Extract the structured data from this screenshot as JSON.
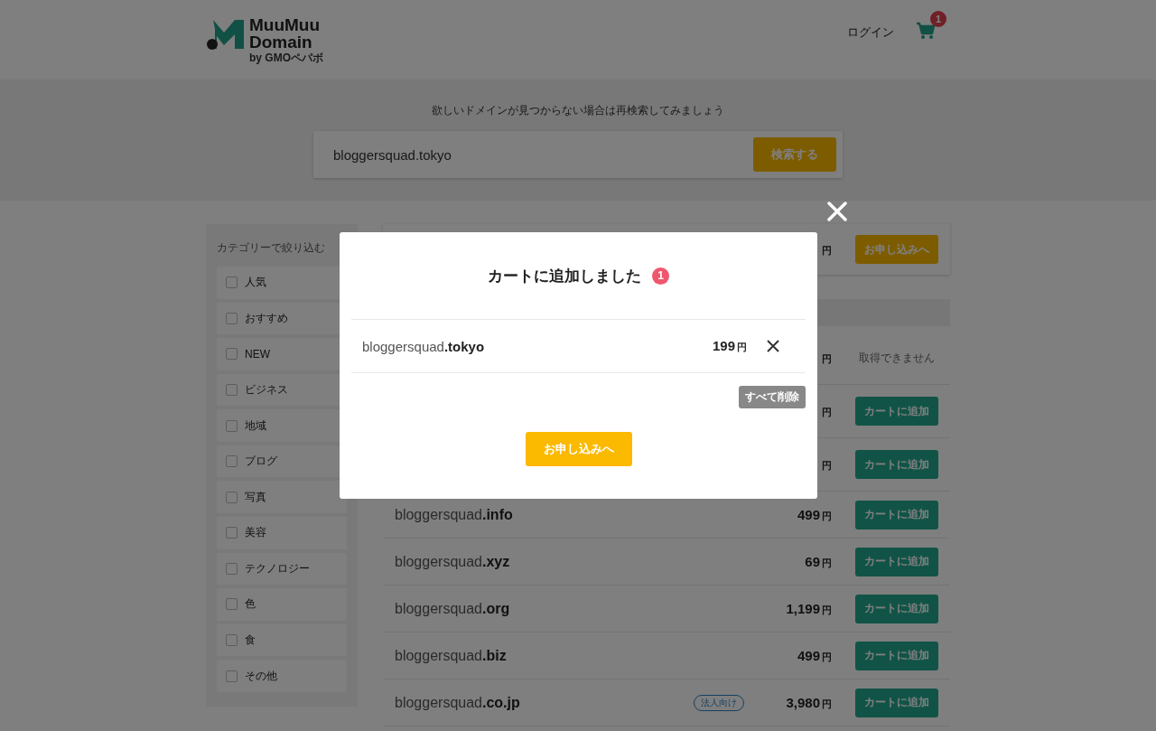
{
  "header": {
    "logo": {
      "line1": "MuuMuu",
      "line2": "Domain",
      "byline": "by GMOペパボ"
    },
    "login": "ログイン",
    "cart_count": "1"
  },
  "search": {
    "prompt": "欲しいドメインが見つからない場合は再検索してみましょう",
    "value": "bloggersquad.tokyo",
    "button": "検索する"
  },
  "sidebar": {
    "title": "カテゴリーで絞り込む",
    "categories": [
      {
        "label": "人気",
        "checked": false
      },
      {
        "label": "おすすめ",
        "checked": false
      },
      {
        "label": "NEW",
        "checked": false
      },
      {
        "label": "ビジネス",
        "checked": false
      },
      {
        "label": "地域",
        "checked": false
      },
      {
        "label": "ブログ",
        "checked": false
      },
      {
        "label": "写真",
        "checked": false
      },
      {
        "label": "美容",
        "checked": false
      },
      {
        "label": "テクノロジー",
        "checked": false
      },
      {
        "label": "色",
        "checked": false
      },
      {
        "label": "食",
        "checked": false
      },
      {
        "label": "その他",
        "checked": false
      }
    ]
  },
  "featured": {
    "currency": "円",
    "button": "お申し込みへ"
  },
  "results": [
    {
      "kind": "unavailable",
      "currency": "円",
      "status": "取得できません"
    },
    {
      "kind": "available",
      "currency": "円",
      "button": "カートに追加"
    },
    {
      "kind": "available",
      "currency": "円",
      "button": "カートに追加"
    },
    {
      "kind": "available",
      "domain": "bloggersquad**.info**",
      "price": "499",
      "currency": "円",
      "button": "カートに追加"
    },
    {
      "kind": "available",
      "domain": "bloggersquad**.xyz**",
      "price": "69",
      "currency": "円",
      "button": "カートに追加"
    },
    {
      "kind": "available",
      "domain": "bloggersquad**.org**",
      "price": "1,199",
      "currency": "円",
      "button": "カートに追加"
    },
    {
      "kind": "available",
      "domain": "bloggersquad**.biz**",
      "price": "499",
      "currency": "円",
      "button": "カートに追加"
    },
    {
      "kind": "available",
      "domain": "bloggersquad**.co.jp**",
      "badge": "法人向け",
      "price": "3,980",
      "currency": "円",
      "button": "カートに追加"
    }
  ],
  "modal": {
    "title": "カートに追加しました",
    "count": "1",
    "items": [
      {
        "domain": "bloggersquad**.tokyo**",
        "price": "199",
        "currency": "円"
      }
    ],
    "clear_button": "すべて削除",
    "checkout_button": "お申し込みへ"
  }
}
